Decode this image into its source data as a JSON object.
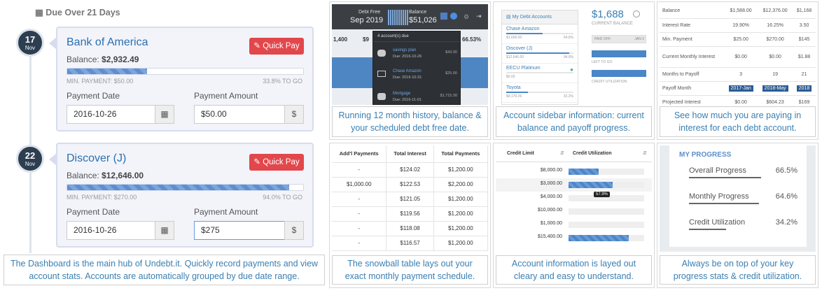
{
  "dashboard": {
    "group_title": "Due Over 21 Days",
    "cards": [
      {
        "day": "17",
        "month": "Nov",
        "account": "Bank of America",
        "balance_label": "Balance:",
        "balance": "$2,932.49",
        "quick_pay": "Quick Pay",
        "progress": 0.338,
        "min_payment": "MIN. PAYMENT: $50.00",
        "to_go": "33.8% TO GO",
        "date_label": "Payment Date",
        "date_value": "2016-10-26",
        "amount_label": "Payment Amount",
        "amount_value": "$50.00",
        "amount_addon": "$"
      },
      {
        "day": "22",
        "month": "Nov",
        "account": "Discover (J)",
        "balance_label": "Balance:",
        "balance": "$12,646.00",
        "quick_pay": "Quick Pay",
        "progress": 0.94,
        "min_payment": "MIN. PAYMENT: $270.00",
        "to_go": "94.0% TO GO",
        "date_label": "Payment Date",
        "date_value": "2016-10-26",
        "amount_label": "Payment Amount",
        "amount_value": "$275",
        "amount_addon": "$"
      }
    ],
    "caption_1": "The Dashboard is the main hub of Undebt.it. Quickly record payments and view",
    "caption_2": "account stats. Accounts are automatically grouped by due date range."
  },
  "history_tile": {
    "debt_free_label": "Debt Free",
    "debt_free_value": "Sep 2019",
    "balance_label": "Balance",
    "balance_value": "$51,026",
    "left_small": [
      "1,400",
      "$9"
    ],
    "right_small": "66.53%",
    "dropdown_header": "4 account(s) due",
    "dropdown_items": [
      {
        "name": "savings plan",
        "due": "Due: 2016-10-26",
        "amt": "$43.00"
      },
      {
        "name": "Chase Amazon",
        "due": "Due: 2016-10-31",
        "amt": "$25.00"
      },
      {
        "name": "Mortgage",
        "due": "Due: 2016-11-01",
        "amt": "$1,715.30"
      }
    ],
    "caption_1": "Running 12 month history, balance &",
    "caption_2": "your scheduled debt free date."
  },
  "sidebar_tile": {
    "header": "My Debt Accounts",
    "accounts": [
      {
        "name": "Chase Amazon",
        "left": "$1,600.00",
        "right": "54.6%"
      },
      {
        "name": "Discover (J)",
        "left": "$12,646.00",
        "right": "94.0%"
      },
      {
        "name": "EECU Platinum",
        "left": "$0.00",
        "right": ""
      },
      {
        "name": "Toyota",
        "left": "$4,170.26",
        "right": "32.2%"
      }
    ],
    "current_balance": "$1,688",
    "current_balance_label": "CURRENT BALANCE",
    "payoff_label": "PAID OFF:",
    "payoff_value": "JAN 2",
    "left_to_go": "LEFT TO GO",
    "credit_util": "CREDIT UTILIZATION",
    "caption_1": "Account sidebar information: current",
    "caption_2": "balance and payoff progress."
  },
  "interest_tile": {
    "rows": [
      {
        "label": "Balance",
        "c1": "$1,588.00",
        "c2": "$12,376.00",
        "c3": "$1,168"
      },
      {
        "label": "Interest Rate",
        "c1": "19.90%",
        "c2": "16.25%",
        "c3": "3.50"
      },
      {
        "label": "Min. Payment",
        "c1": "$25.00",
        "c2": "$270.00",
        "c3": "$145"
      },
      {
        "label": "Current Monthly Interest",
        "c1": "$0.00",
        "c2": "$0.00",
        "c3": "$1.88"
      },
      {
        "label": "Months to Payoff",
        "c1": "3",
        "c2": "19",
        "c3": "21"
      },
      {
        "label": "Payoff Month",
        "c1": "2017-Jan",
        "c2": "2018-May",
        "c3": "2018"
      },
      {
        "label": "Projected Interest",
        "c1": "$0.00",
        "c2": "$604.23",
        "c3": "$169"
      }
    ],
    "caption_1": "See how much you are paying in",
    "caption_2": "interest for each debt account."
  },
  "snowball_tile": {
    "headers": [
      "Add'l Payments",
      "Total Interest",
      "Total Payments"
    ],
    "rows": [
      [
        "-",
        "$124.02",
        "$1,200.00"
      ],
      [
        "$1,000.00",
        "$122.53",
        "$2,200.00"
      ],
      [
        "-",
        "$121.05",
        "$1,200.00"
      ],
      [
        "-",
        "$119.56",
        "$1,200.00"
      ],
      [
        "-",
        "$118.08",
        "$1,200.00"
      ],
      [
        "-",
        "$116.57",
        "$1,200.00"
      ]
    ],
    "caption_1": "The snowball table lays out your",
    "caption_2": "exact monthly payment schedule."
  },
  "credit_tile": {
    "headers": [
      "Credit Limit",
      "Credit Utilization"
    ],
    "rows": [
      {
        "limit": "$8,000.00",
        "util": 0.4
      },
      {
        "limit": "$3,000.00",
        "util": 0.58
      },
      {
        "limit": "$4,000.00",
        "util": 0
      },
      {
        "limit": "$10,000.00",
        "util": 0
      },
      {
        "limit": "$1,000.00",
        "util": 0
      },
      {
        "limit": "$15,400.00",
        "util": 0.8
      }
    ],
    "tooltip": "57.9%",
    "caption_1": "Account information is layed out",
    "caption_2": "cleary and easy to understand."
  },
  "progress_tile": {
    "title": "MY PROGRESS",
    "items": [
      {
        "label": "Overall Progress",
        "value": "66.5%",
        "fraction": 0.665
      },
      {
        "label": "Monthly Progress",
        "value": "64.6%",
        "fraction": 0.646
      },
      {
        "label": "Credit Utilization",
        "value": "34.2%",
        "fraction": 0.342
      }
    ],
    "caption_1": "Always be on top of your key",
    "caption_2": "progress stats & credit utilization."
  }
}
